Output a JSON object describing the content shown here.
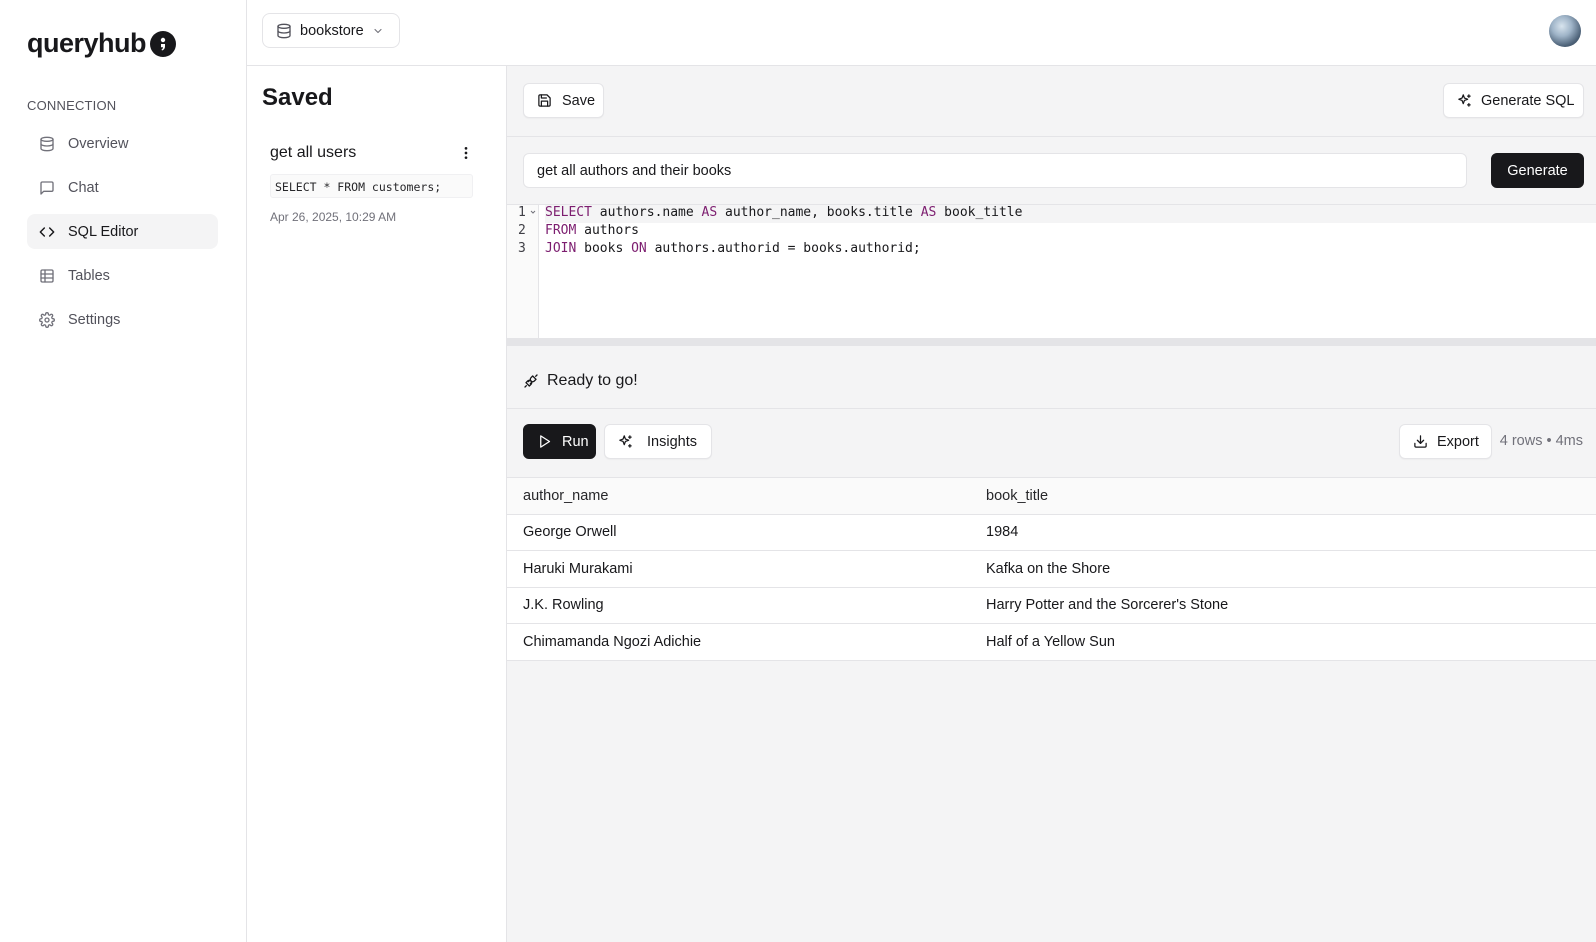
{
  "app": {
    "name": "queryhub"
  },
  "sidebar": {
    "section_label": "CONNECTION",
    "items": [
      {
        "label": "Overview",
        "icon": "database-icon"
      },
      {
        "label": "Chat",
        "icon": "message-icon"
      },
      {
        "label": "SQL Editor",
        "icon": "code-icon",
        "active": true
      },
      {
        "label": "Tables",
        "icon": "table-icon"
      },
      {
        "label": "Settings",
        "icon": "gear-icon"
      }
    ]
  },
  "topbar": {
    "database": "bookstore"
  },
  "saved": {
    "title": "Saved",
    "items": [
      {
        "name": "get all users",
        "query": "SELECT * FROM customers;",
        "date": "Apr 26, 2025, 10:29 AM"
      }
    ]
  },
  "toolbar": {
    "save_label": "Save",
    "generate_sql_label": "Generate SQL"
  },
  "prompt": {
    "value": "get all authors and their books",
    "generate_label": "Generate"
  },
  "editor": {
    "line_numbers": [
      "1",
      "2",
      "3"
    ],
    "lines": [
      "SELECT authors.name AS author_name, books.title AS book_title",
      "FROM authors",
      "JOIN books ON authors.authorid = books.authorid;"
    ]
  },
  "status": {
    "text": "Ready to go!"
  },
  "actions": {
    "run_label": "Run",
    "insights_label": "Insights",
    "export_label": "Export",
    "meta": "4 rows • 4ms"
  },
  "results": {
    "columns": [
      "author_name",
      "book_title"
    ],
    "rows": [
      [
        "George Orwell",
        "1984"
      ],
      [
        "Haruki Murakami",
        "Kafka on the Shore"
      ],
      [
        "J.K. Rowling",
        "Harry Potter and the Sorcerer's Stone"
      ],
      [
        "Chimamanda Ngozi Adichie",
        "Half of a Yellow Sun"
      ]
    ]
  },
  "colors": {
    "accent_dark": "#18181b",
    "keyword": "#7c1d6f",
    "border": "#e4e4e7"
  }
}
